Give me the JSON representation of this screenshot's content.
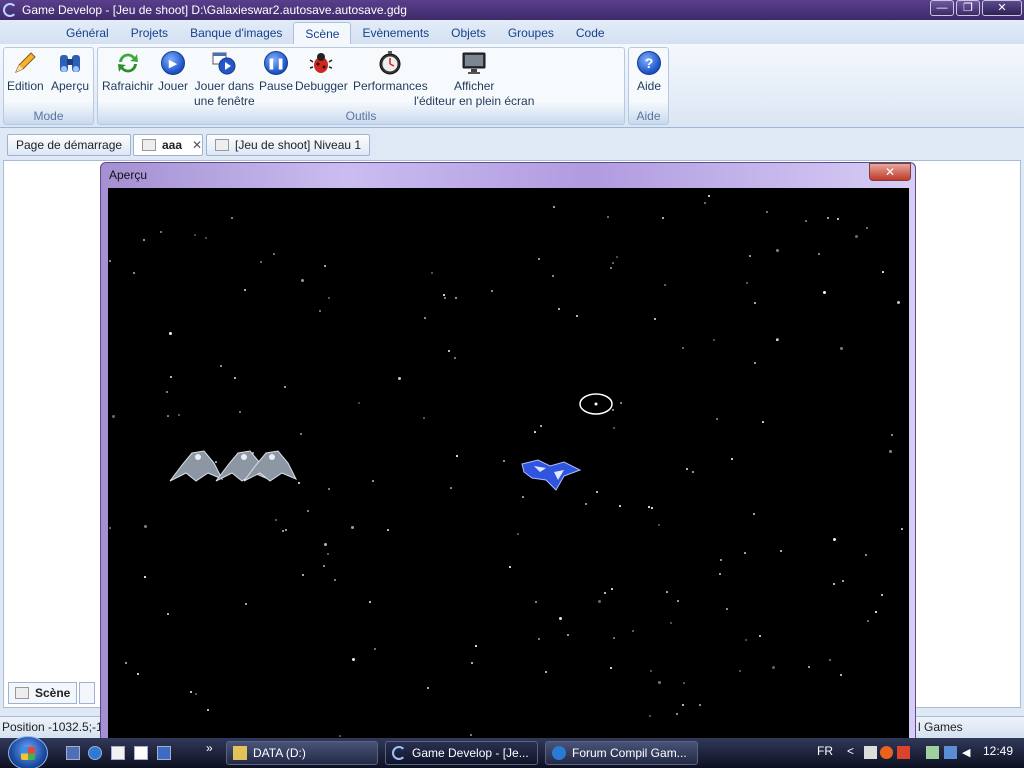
{
  "window": {
    "title": "Game Develop - [Jeu de shoot] D:\\Galaxieswar2.autosave.autosave.gdg",
    "buttons": {
      "minimize": "—",
      "maximize": "❐",
      "close": "✕"
    }
  },
  "ribbon_tabs": [
    "Général",
    "Projets",
    "Banque d'images",
    "Scène",
    "Evènements",
    "Objets",
    "Groupes",
    "Code"
  ],
  "ribbon_active_tab": "Scène",
  "groups": {
    "mode": {
      "label": "Mode",
      "buttons": [
        {
          "label": "Edition",
          "icon": "pencil-icon"
        },
        {
          "label": "Aperçu",
          "icon": "binoculars-icon"
        }
      ]
    },
    "outils": {
      "label": "Outils",
      "buttons": [
        {
          "label": "Rafraichir",
          "icon": "refresh-icon"
        },
        {
          "label": "Jouer",
          "icon": "play-icon"
        },
        {
          "label_line1": "Jouer dans",
          "label_line2": "une fenêtre",
          "icon": "play-window-icon"
        },
        {
          "label": "Pause",
          "icon": "pause-icon"
        },
        {
          "label": "Debugger",
          "icon": "bug-icon"
        },
        {
          "label": "Performances",
          "icon": "stopwatch-icon"
        },
        {
          "label_line1": "Afficher",
          "label_line2": "l'éditeur en plein écran",
          "icon": "monitor-icon"
        }
      ]
    },
    "aide": {
      "label": "Aide",
      "buttons": [
        {
          "label": "Aide",
          "icon": "help-icon"
        }
      ]
    }
  },
  "doc_tabs": [
    {
      "label": "Page de démarrage"
    },
    {
      "label": "aaa",
      "active": true,
      "close": "✕"
    },
    {
      "label": "[Jeu de shoot] Niveau 1"
    }
  ],
  "bottom_tabs": [
    "Scène"
  ],
  "status": {
    "position": "Position -1032.5;-1",
    "right_text": "l Games"
  },
  "preview": {
    "title": "Aperçu",
    "close": "✕"
  },
  "taskbar": {
    "tasks": [
      {
        "label": "DATA (D:)"
      },
      {
        "label": "Game Develop - [Je...",
        "active": true
      },
      {
        "label": "Forum Compil Gam..."
      }
    ],
    "language": "FR",
    "overflow": "»",
    "tray_chevron": "<",
    "clock": "12:49"
  },
  "colors": {
    "titlebar": "#3e2a6a",
    "ribbon": "#dbe6f4",
    "game_bg": "#000000",
    "player_ship": "#2f55e0"
  }
}
